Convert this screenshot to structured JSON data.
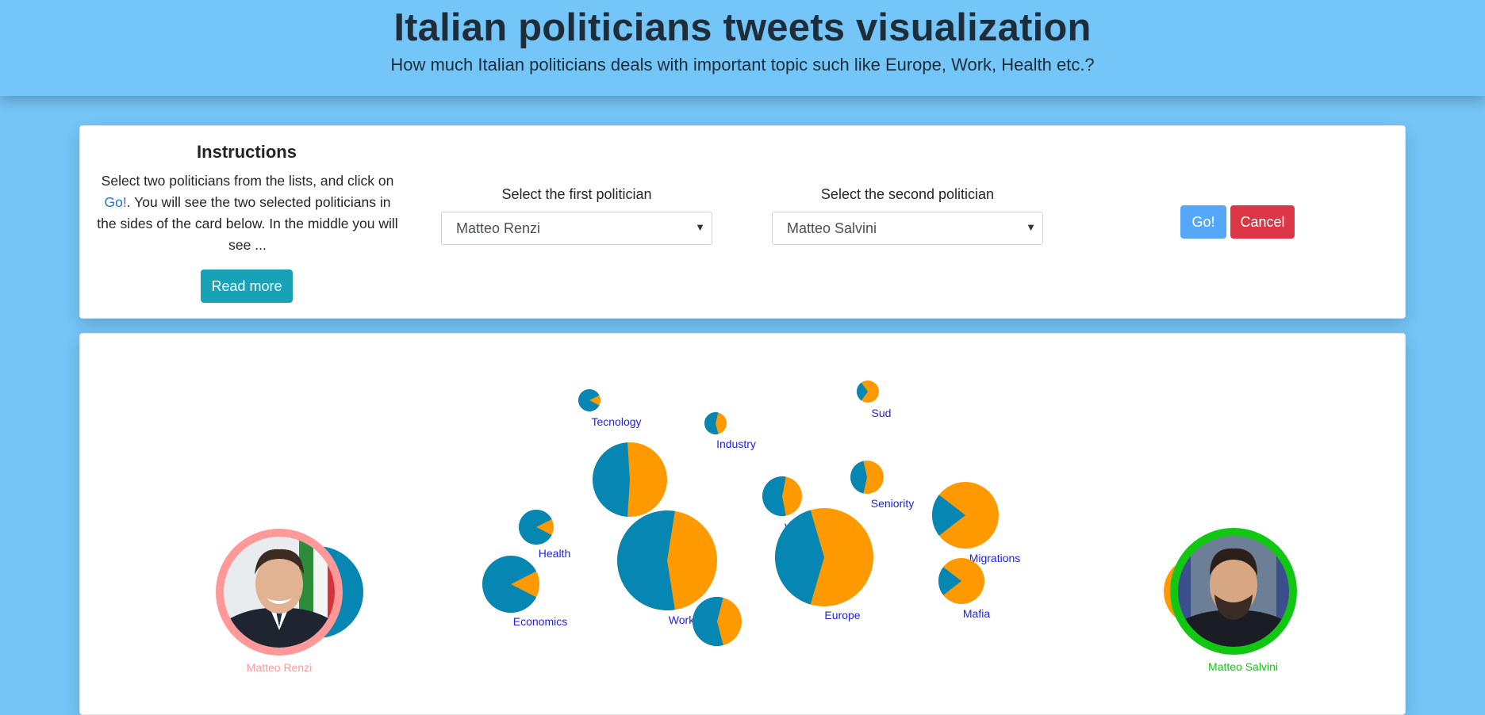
{
  "header": {
    "title": "Italian politicians tweets visualization",
    "subtitle": "How much Italian politicians deals with important topic such like Europe, Work, Health etc.?"
  },
  "instructions": {
    "title": "Instructions",
    "text_before": "Select two politicians from the lists, and click on ",
    "go_link": "Go!",
    "text_after": ". You will see the two selected politicians in the sides of the card below. In the middle you will see ...",
    "read_more": "Read more"
  },
  "selects": {
    "first_label": "Select the first politician",
    "first_value": "Matteo Renzi",
    "second_label": "Select the second politician",
    "second_value": "Matteo Salvini"
  },
  "buttons": {
    "go": "Go!",
    "cancel": "Cancel"
  },
  "colors": {
    "politician1": "#0686b2",
    "politician2": "#ff9900",
    "label": "#2222dd",
    "renzi_ring": "#ff9999",
    "salvini_ring": "#11c711"
  },
  "politicians": {
    "left": {
      "name": "Matteo Renzi",
      "color": "#ff9999"
    },
    "right": {
      "name": "Matteo Salvini",
      "color": "#11c711"
    }
  },
  "topics": [
    {
      "label": "Tecnology",
      "share_first": 0.85
    },
    {
      "label": "Industry",
      "share_first": 0.58
    },
    {
      "label": "Sud",
      "share_first": 0.3
    },
    {
      "label": "Seniority",
      "share_first": 0.43
    },
    {
      "label": "Women",
      "share_first": 0.56
    },
    {
      "label": "Migrations",
      "share_first": 0.21
    },
    {
      "label": "Health",
      "share_first": 0.85
    },
    {
      "label": "Economics",
      "share_first": 0.85
    },
    {
      "label": "Work",
      "share_first": 0.55
    },
    {
      "label": "Europe",
      "share_first": 0.41
    },
    {
      "label": "Mafia",
      "share_first": 0.21
    },
    {
      "label": "",
      "share_first": 0.48
    },
    {
      "label": "",
      "share_first": 0.58
    }
  ]
}
